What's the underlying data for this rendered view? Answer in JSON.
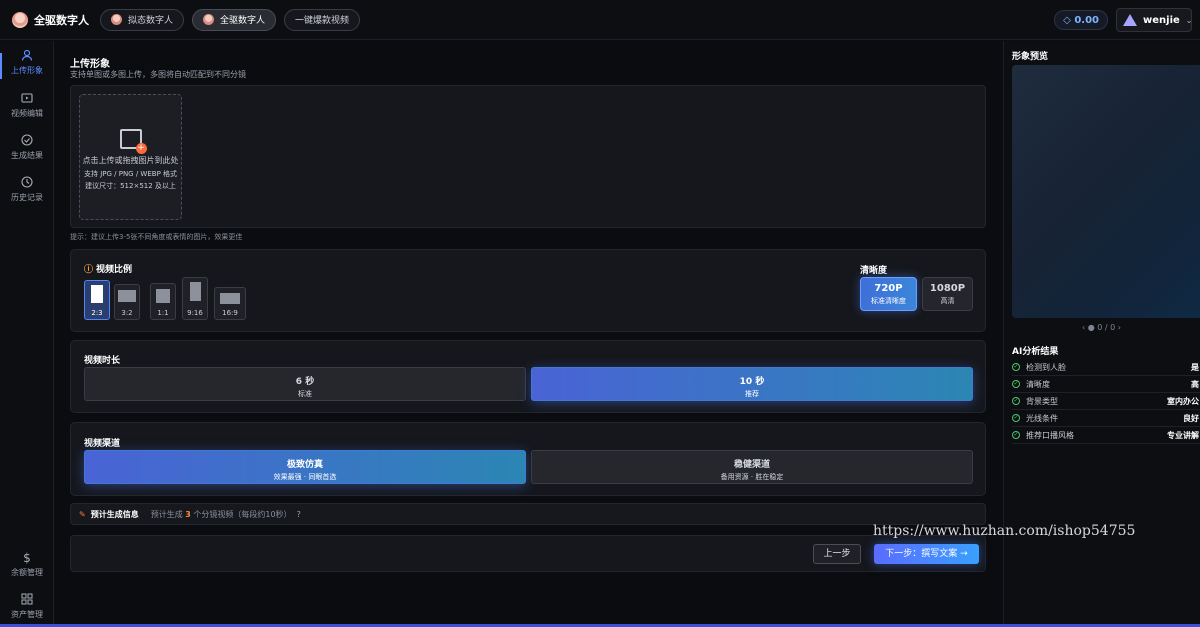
{
  "app": {
    "title": "全驱数字人"
  },
  "nav": {
    "tabs": [
      {
        "label": "拟态数字人"
      },
      {
        "label": "全驱数字人"
      },
      {
        "label": "一键爆款视频"
      }
    ]
  },
  "account": {
    "balance": "◇ 0.00",
    "username": "wenjie",
    "caret": "⌄"
  },
  "sidebar": {
    "items": [
      {
        "label": "上传形象",
        "icon": "user-icon"
      },
      {
        "label": "视频编辑",
        "icon": "video-edit-icon"
      },
      {
        "label": "生成结果",
        "icon": "check-circle-icon"
      },
      {
        "label": "历史记录",
        "icon": "clock-icon"
      },
      {
        "label": "余额管理",
        "icon": "dollar-icon"
      },
      {
        "label": "资产管理",
        "icon": "grid-icon"
      }
    ]
  },
  "upload": {
    "title": "上传形象",
    "subtitle": "支持单图或多图上传，多图将自动匹配到不同分镜",
    "drop_text": "点击上传或拖拽图片到此处",
    "formats": "支持 JPG / PNG / WEBP 格式",
    "size_hint": "建议尺寸：512×512 及以上",
    "tip": "提示：建议上传3-5张不同角度或表情的图片，效果更佳"
  },
  "ratio": {
    "title": "视频比例",
    "options": [
      "2:3",
      "3:2",
      "1:1",
      "9:16",
      "16:9"
    ],
    "selected": "2:3"
  },
  "resolution": {
    "title": "清晰度",
    "options": [
      {
        "label": "720P",
        "desc": "标准清晰度"
      },
      {
        "label": "1080P",
        "desc": "高清"
      }
    ],
    "selected": "720P"
  },
  "duration": {
    "title": "视频时长",
    "options": [
      {
        "label": "6 秒",
        "desc": "标准"
      },
      {
        "label": "10 秒",
        "desc": "推荐"
      }
    ],
    "selected": "10 秒"
  },
  "channel": {
    "title": "视频渠道",
    "options": [
      {
        "label": "极致仿真",
        "desc": "效果最强 · 同眼首选"
      },
      {
        "label": "稳健渠道",
        "desc": "备用资源 · 胜在稳定"
      }
    ],
    "selected": "极致仿真"
  },
  "estimate": {
    "label": "预计生成信息",
    "prefix": "预计生成",
    "count": "3",
    "suffix": "个分镜视频（每段约10秒）",
    "help": "?"
  },
  "actions": {
    "prev": "上一步",
    "next": "下一步：撰写文案 →"
  },
  "preview": {
    "title": "形象预览",
    "pager": "‹   ● 0 / 0   ›"
  },
  "analysis": {
    "title": "AI分析结果",
    "rows": [
      {
        "label": "检测到人脸",
        "value": "是"
      },
      {
        "label": "清晰度",
        "value": "高"
      },
      {
        "label": "背景类型",
        "value": "室内办公"
      },
      {
        "label": "光线条件",
        "value": "良好"
      },
      {
        "label": "推荐口播风格",
        "value": "专业讲解"
      }
    ]
  },
  "watermark": "https://www.huzhan.com/ishop54755",
  "colors": {
    "accent": "#4f86ff",
    "warning": "#ff8a3d",
    "success": "#4cc36a"
  }
}
